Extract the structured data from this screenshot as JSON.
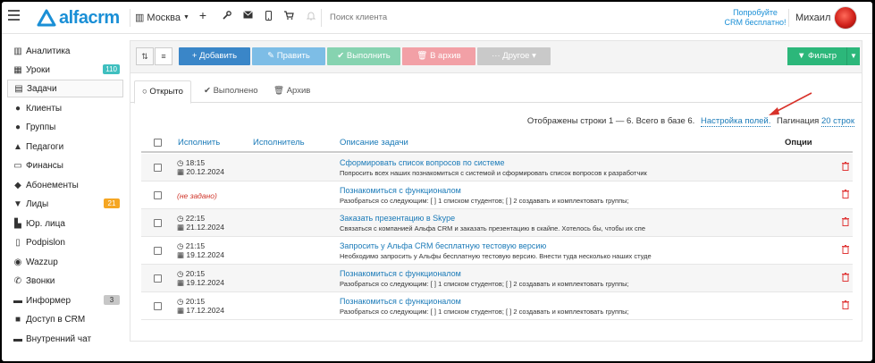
{
  "header": {
    "logo": "alfacrm",
    "city": "Москва",
    "search_placeholder": "Поиск клиента",
    "promo": [
      "Попробуйте",
      "CRM бесплатно!"
    ],
    "user": "Михаил"
  },
  "sidebar": {
    "items": [
      {
        "label": "Аналитика",
        "icon": "chart-icon"
      },
      {
        "label": "Уроки",
        "icon": "calendar-icon",
        "badge": "110"
      },
      {
        "label": "Задачи",
        "icon": "clipboard-icon",
        "active": true
      },
      {
        "label": "Клиенты",
        "icon": "user-icon"
      },
      {
        "label": "Группы",
        "icon": "users-icon"
      },
      {
        "label": "Педагоги",
        "icon": "graduation-cap-icon"
      },
      {
        "label": "Финансы",
        "icon": "money-icon"
      },
      {
        "label": "Абонементы",
        "icon": "tag-icon"
      },
      {
        "label": "Лиды",
        "icon": "funnel-icon",
        "badge": "21"
      },
      {
        "label": "Юр. лица",
        "icon": "building-icon"
      },
      {
        "label": "Podpislon",
        "icon": "document-icon"
      },
      {
        "label": "Wazzup",
        "icon": "whatsapp-icon"
      },
      {
        "label": "Звонки",
        "icon": "phone-icon"
      },
      {
        "label": "Информер",
        "icon": "informer-icon",
        "badge": "3"
      },
      {
        "label": "Доступ в CRM",
        "icon": "lock-icon"
      },
      {
        "label": "Внутренний чат",
        "icon": "chat-icon"
      }
    ]
  },
  "toolbar": {
    "add": "+ Добавить",
    "edit": "✎ Править",
    "done": "✔ Выполнить",
    "archive": "🗑 В архив",
    "other": "··· Другое ▾",
    "filter": "▼ Фильтр"
  },
  "tabs": [
    {
      "label": "○ Открыто"
    },
    {
      "label": "✔ Выполнено"
    },
    {
      "label": "🗑 Архив"
    }
  ],
  "summary": {
    "text": "Отображены строки 1 — 6. Всего в базе 6.",
    "settings": "Настройка полей.",
    "pagination_label": "Пагинация",
    "pagination_link": "20 строк"
  },
  "table": {
    "headers": {
      "execute": "Исполнить",
      "executor": "Исполнитель",
      "description": "Описание задачи",
      "options": "Опции"
    },
    "rows": [
      {
        "time": "◷ 18:15",
        "date": "▦ 20.12.2024",
        "title": "Сформировать список вопросов по системе",
        "desc": "Попросить всех наших познакомиться с системой и сформировать список вопросов к разработчик"
      },
      {
        "none": "(не задано)",
        "title": "Познакомиться с функционалом",
        "desc": "Разобраться со следующим: [ ] 1 списком студентов; [ ] 2 создавать и комплектовать группы;"
      },
      {
        "time": "◷ 22:15",
        "date": "▦ 21.12.2024",
        "title": "Заказать презентацию в Skype",
        "desc": "Связаться с компанией Альфа CRM и заказать презентацию в скайпе. Хотелось бы, чтобы их спе"
      },
      {
        "time": "◷ 21:15",
        "date": "▦ 19.12.2024",
        "title": "Запросить у Альфа CRM бесплатную тестовую версию",
        "desc": "Необходимо запросить у Альфы бесплатную тестовую версию. Внести туда несколько наших студе"
      },
      {
        "time": "◷ 20:15",
        "date": "▦ 19.12.2024",
        "title": "Познакомиться с функционалом",
        "desc": "Разобраться со следующим: [ ] 1 списком студентов; [ ] 2 создавать и комплектовать группы;"
      },
      {
        "time": "◷ 20:15",
        "date": "▦ 17.12.2024",
        "title": "Познакомиться с функционалом",
        "desc": "Разобраться со следующим: [ ] 1 списком студентов; [ ] 2 создавать и комплектовать группы;"
      }
    ]
  },
  "colors": {
    "brand": "#1a8fd6",
    "add": "#3a86c8",
    "edit": "#7dbde6",
    "done": "#86d3b0",
    "archive": "#f2a0a6",
    "other": "#c9c9c9",
    "filter": "#2cb77a",
    "badge_green": "#3fbfbf",
    "badge_orange": "#f5a623",
    "badge_gray": "#c7c7c7",
    "danger": "#e03a3a"
  }
}
